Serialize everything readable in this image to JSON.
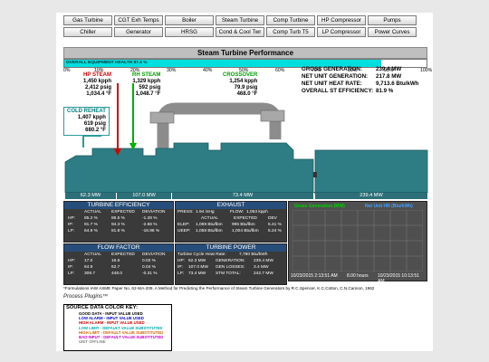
{
  "nav": {
    "row1": [
      "Gas Turbine",
      "CGT Exh Temps",
      "Boiler",
      "Steam Turbine",
      "Comp Turbine",
      "HP Compressor",
      "Pumps"
    ],
    "row2": [
      "Chiller",
      "Generator",
      "HRSG",
      "Cond & Cool Twr",
      "Comp Turb T5",
      "LP Compressor",
      "Power Curves"
    ]
  },
  "title": "Steam Turbine Performance",
  "health": {
    "label": "OVERALL EQUIPMENT HEALTH",
    "value_text": "87.4 %",
    "fraction": 0.874
  },
  "health_ticks": [
    "0%",
    "10%",
    "20%",
    "30%",
    "40%",
    "50%",
    "60%",
    "70%",
    "80%",
    "90%",
    "100%"
  ],
  "hp_steam": {
    "title": "HP STEAM",
    "flow": "1,450 kpph",
    "pressure": "2,412 psig",
    "temp": "1,034.4 °F"
  },
  "rh_steam": {
    "title": "RH STEAM",
    "flow": "1,329 kpph",
    "pressure": "592 psig",
    "temp": "1,048.7 °F"
  },
  "crossover": {
    "title": "CROSSOVER",
    "flow": "1,254 kpph",
    "pressure": "79.9 psig",
    "temp": "468.0 °F"
  },
  "cold_reheat": {
    "title": "COLD REHEAT",
    "flow": "1,407 kpph",
    "pressure": "619 psig",
    "temp": "680.2 °F"
  },
  "summary": [
    {
      "label": "GROSS GENERATION:",
      "value": "239.4 MW"
    },
    {
      "label": "NET UNIT GENERATION:",
      "value": "217.8 MW"
    },
    {
      "label": "NET UNIT HEAT RATE:",
      "value": "9,713.6 Btu/kWh"
    },
    {
      "label": "OVERALL ST EFFICIENCY:",
      "value": "81.9 %"
    }
  ],
  "mw_bar": [
    "62.3 MW",
    "107.0 MW",
    "73.4 MW",
    "239.4 MW"
  ],
  "turbine_efficiency": {
    "title": "TURBINE EFFICIENCY",
    "headers": [
      "ACTUAL",
      "EXPECTED",
      "DEVIATION"
    ],
    "rows": [
      {
        "label": "HP:",
        "actual": "85.2 %",
        "expected": "86.5 %",
        "deviation": "-1.28 %"
      },
      {
        "label": "IP:",
        "actual": "91.7 %",
        "expected": "94.3 %",
        "deviation": "-2.66 %"
      },
      {
        "label": "LP:",
        "actual": "64.9 %",
        "expected": "81.8 %",
        "deviation": "-16.96 %"
      }
    ]
  },
  "exhaust": {
    "title": "EXHAUST",
    "row1": {
      "press_label": "PRESS:",
      "press": "1.94 inHg",
      "flow_label": "FLOW:",
      "flow": "1,053 kpph"
    },
    "headers": [
      "ACTUAL",
      "EXPECTED",
      "DEV"
    ],
    "rows": [
      {
        "label": "ELEP:",
        "actual": "1,069 Btu/lbm",
        "expected": "995 Btu/lbm",
        "dev": "5.41 %"
      },
      {
        "label": "UEEP:",
        "actual": "1,058 Btu/lbm",
        "expected": "1,004 Btu/lbm",
        "dev": "5.24 %"
      }
    ]
  },
  "flow_factor": {
    "title": "FLOW FACTOR",
    "headers": [
      "ACTUAL",
      "EXPECTED",
      "DEVIATION"
    ],
    "rows": [
      {
        "label": "HP:",
        "actual": "17.0",
        "expected": "16.6",
        "deviation": "0.02 %"
      },
      {
        "label": "IP:",
        "actual": "64.9",
        "expected": "62.7",
        "deviation": "0.04 %"
      },
      {
        "label": "LP:",
        "actual": "309.7",
        "expected": "448.0",
        "deviation": "-0.31 %"
      }
    ]
  },
  "turbine_power": {
    "title": "TURBINE POWER",
    "heat_rate_label": "Turbine Cycle Heat Rate:",
    "heat_rate": "7,780 Btu/kWh",
    "rows": [
      {
        "l1": "HP:",
        "v1": "62.3 MW",
        "l2": "GENERATION:",
        "v2": "239.4 MW"
      },
      {
        "l1": "IP:",
        "v1": "107.0 MW",
        "l2": "GEN LOSSES:",
        "v2": "3.4 MW"
      },
      {
        "l1": "LP:",
        "v1": "73.4 MW",
        "l2": "STM TOTAL:",
        "v2": "242.7 MW"
      }
    ]
  },
  "trend": {
    "legend_left": "Gross Generation (MW)",
    "legend_right": "Net Unit HR (Btu/kWh)",
    "time_left": "10/23/2015 2:13:51 AM",
    "span": "8.00 hours",
    "time_right": "10/23/2015 10:13:51 AM"
  },
  "footnote": "*Formulations IAW ASME Paper No. 62-WA-209, A Method for Predicting the Performance of Steam Turbine Generators by R.C.Spencer, K.C.Cotton, C.N.Cannon, 1962",
  "plugins_label": "Process Plugins™",
  "key": {
    "title": "SOURCE DATA COLOR KEY:",
    "items": [
      {
        "text": "GOOD DATA - INPUT VALUE USED",
        "color": "#000000"
      },
      {
        "text": "LOW ALARM - INPUT VALUE USED",
        "color": "#0000cc"
      },
      {
        "text": "HIGH ALARM - INPUT VALUE USED",
        "color": "#cc0000"
      },
      {
        "text": "LOW LIMIT - DEFAULT VALUE SUBSTITUTED",
        "color": "#00aaaa"
      },
      {
        "text": "HIGH LIMIT - DEFAULT VALUE SUBSTITUTED",
        "color": "#cc6600"
      },
      {
        "text": "BAD INPUT - DEFAULT VALUE SUBSTITUTED",
        "color": "#cc00cc"
      },
      {
        "text": "UNIT OFFLINE",
        "color": "#888888"
      }
    ]
  },
  "colors": {
    "turbine": "#2e7d84",
    "pipe": "#9a9a9a",
    "health_fill": "#00dede",
    "panel_header": "#274e7a"
  }
}
